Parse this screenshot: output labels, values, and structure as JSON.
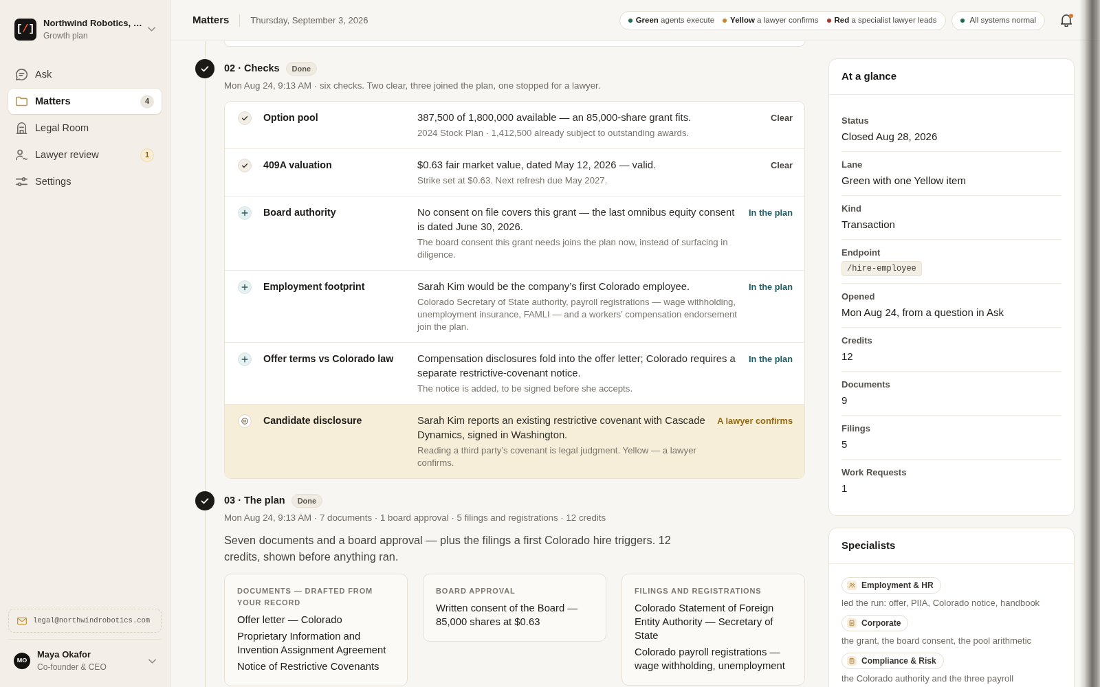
{
  "sidebar": {
    "org": {
      "logo": [
        {
          "text": "[",
          "accent": false
        },
        {
          "text": "/",
          "accent": true
        },
        {
          "text": "]",
          "accent": false
        }
      ],
      "name": "Northwind Robotics, …",
      "plan": "Growth plan"
    },
    "nav": [
      {
        "label": "Ask",
        "selected": false
      },
      {
        "label": "Matters",
        "selected": true,
        "badge": {
          "text": "4",
          "kind": "count"
        }
      },
      {
        "label": "Legal Room",
        "selected": false
      },
      {
        "label": "Lawyer review",
        "selected": false,
        "badge": {
          "text": "1",
          "kind": "alert"
        }
      },
      {
        "label": "Settings",
        "selected": false
      }
    ],
    "email": "legal@northwindrobotics.com",
    "user": {
      "initials": "MO",
      "name": "Maya Okafor",
      "role": "Co-founder & CEO"
    }
  },
  "header": {
    "title": "Matters",
    "date": "Thursday, September 3, 2026",
    "lanes": [
      {
        "text": "**Green** agents execute",
        "color": "#1f6b4f"
      },
      {
        "text": "**Yellow** a lawyer confirms",
        "color": "#c4892b"
      },
      {
        "text": "**Red** a specialist lawyer leads",
        "color": "#a8382b"
      }
    ],
    "system_status": {
      "text": "All systems normal",
      "ok": true
    },
    "notifications": {
      "unread": true
    }
  },
  "timeline": {
    "steps": [
      {
        "title": "02 · Checks",
        "status": "Done",
        "done": true,
        "meta": "Mon Aug 24, 9:13 AM · six checks. Two clear, three joined the plan, one stopped for a lawyer.",
        "checks": [
          {
            "name": "Option pool",
            "summary": "387,500 of 1,800,000 available — an 85,000-share grant fits.",
            "detail": "2024 Stock Plan · 1,412,500 already subject to outstanding awards.",
            "status": "Clear",
            "kind": "clear"
          },
          {
            "name": "409A valuation",
            "summary": "$0.63 fair market value, dated May 12, 2026 — valid.",
            "detail": "Strike set at $0.63. Next refresh due May 2027.",
            "status": "Clear",
            "kind": "clear"
          },
          {
            "name": "Board authority",
            "summary": "No consent on file covers this grant — the last omnibus equity consent is dated June 30, 2026.",
            "detail": "The board consent this grant needs joins the plan now, instead of surfacing in diligence.",
            "status": "In the plan",
            "kind": "plan"
          },
          {
            "name": "Employment footprint",
            "summary": "Sarah Kim would be the company’s first Colorado employee.",
            "detail": "Colorado Secretary of State authority, payroll registrations — wage withholding, unemployment insurance, FAMLI — and a workers’ compensation endorsement join the plan.",
            "status": "In the plan",
            "kind": "plan"
          },
          {
            "name": "Offer terms vs Colorado law",
            "summary": "Compensation disclosures fold into the offer letter; Colorado requires a separate restrictive-covenant notice.",
            "detail": "The notice is added, to be signed before she accepts.",
            "status": "In the plan",
            "kind": "plan"
          },
          {
            "name": "Candidate disclosure",
            "summary": "Sarah Kim reports an existing restrictive covenant with Cascade Dynamics, signed in Washington.",
            "detail": "Reading a third party’s covenant is legal judgment. Yellow — a lawyer confirms.",
            "status": "A lawyer confirms",
            "kind": "lawyer"
          }
        ]
      },
      {
        "title": "03 · The plan",
        "status": "Done",
        "done": true,
        "meta": "Mon Aug 24, 9:13 AM · 7 documents · 1 board approval · 5 filings and registrations · 12 credits",
        "summary": "Seven documents and a board approval — plus the filings a first Colorado hire triggers. 12 credits, shown before anything ran.",
        "groups": [
          {
            "heading": "DOCUMENTS — DRAFTED FROM YOUR RECORD",
            "items": [
              "Offer letter — Colorado",
              "Proprietary Information and Invention Assignment Agreement",
              "Notice of Restrictive Covenants"
            ]
          },
          {
            "heading": "BOARD APPROVAL",
            "items": [
              "Written consent of the Board — 85,000 shares at $0.63"
            ]
          },
          {
            "heading": "FILINGS AND REGISTRATIONS",
            "items": [
              "Colorado Statement of Foreign Entity Authority — Secretary of State",
              "Colorado payroll registrations — wage withholding, unemployment"
            ]
          }
        ]
      }
    ]
  },
  "at_a_glance": {
    "title": "At a glance",
    "fields": [
      {
        "label": "Status",
        "value": "Closed Aug 28, 2026",
        "kind": "text"
      },
      {
        "label": "Lane",
        "value": "Green with one Yellow item",
        "kind": "text"
      },
      {
        "label": "Kind",
        "value": "Transaction",
        "kind": "text"
      },
      {
        "label": "Endpoint",
        "value": "/hire-employee",
        "kind": "code"
      },
      {
        "label": "Opened",
        "value": "Mon Aug 24, from a question in Ask",
        "kind": "text"
      },
      {
        "label": "Credits",
        "value": "12",
        "kind": "text"
      },
      {
        "label": "Documents",
        "value": "9",
        "kind": "text"
      },
      {
        "label": "Filings",
        "value": "5",
        "kind": "text"
      },
      {
        "label": "Work Requests",
        "value": "1",
        "kind": "text"
      }
    ]
  },
  "specialists": {
    "title": "Specialists",
    "items": [
      {
        "name": "Employment & HR",
        "note": "led the run: offer, PIIA, Colorado notice, handbook"
      },
      {
        "name": "Corporate",
        "note": "the grant, the board consent, the pool arithmetic"
      },
      {
        "name": "Compliance & Risk",
        "note": "the Colorado authority and the three payroll"
      }
    ]
  }
}
